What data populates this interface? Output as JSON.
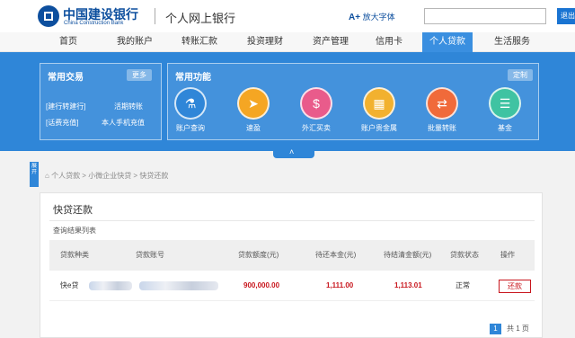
{
  "header": {
    "bank_name_cn": "中国建设银行",
    "bank_name_en": "China Construction Bank",
    "portal_title": "个人网上银行",
    "font_size_label": "放大字体",
    "font_size_glyph": "A+",
    "exit_label": "退出"
  },
  "nav": {
    "items": [
      "首页",
      "我的账户",
      "转账汇款",
      "投资理财",
      "资产管理",
      "信用卡",
      "个人贷款",
      "生活服务"
    ],
    "active": "个人贷款"
  },
  "banner": {
    "common_trade": {
      "title": "常用交易",
      "more_label": "更多",
      "links": [
        "[建行转建行]",
        "活期转账",
        "[话费充值]",
        "本人手机充值"
      ]
    },
    "common_functions": {
      "title": "常用功能",
      "customize_label": "定制",
      "items": [
        {
          "label": "账户查询",
          "icon": "account-query-icon",
          "color": "#2f86d8"
        },
        {
          "label": "速盈",
          "icon": "suying-icon",
          "color": "#f5a623"
        },
        {
          "label": "外汇买卖",
          "icon": "forex-icon",
          "color": "#e95b8b"
        },
        {
          "label": "账户贵金属",
          "icon": "gold-bars-icon",
          "color": "#f2b12f"
        },
        {
          "label": "批量转账",
          "icon": "batch-transfer-icon",
          "color": "#f06a3a"
        },
        {
          "label": "基金",
          "icon": "fund-icon",
          "color": "#3fc3a2"
        }
      ]
    }
  },
  "side_tag": "展开",
  "breadcrumb": {
    "items": [
      "个人贷款",
      "小微企业快贷",
      "快贷还款"
    ]
  },
  "main": {
    "title": "快贷还款",
    "section_label": "查询结果列表",
    "table": {
      "headers": [
        "贷款种类",
        "贷款账号",
        "贷款额度(元)",
        "待还本金(元)",
        "待结清金额(元)",
        "贷款状态",
        "操作"
      ],
      "rows": [
        {
          "type": "快e贷",
          "account": "",
          "limit": "900,000.00",
          "principal": "1,111.00",
          "settle_amount": "1,113.01",
          "status": "正常",
          "action": "还款"
        }
      ]
    },
    "pager": {
      "current": "1",
      "total_label": "共 1 页"
    }
  }
}
